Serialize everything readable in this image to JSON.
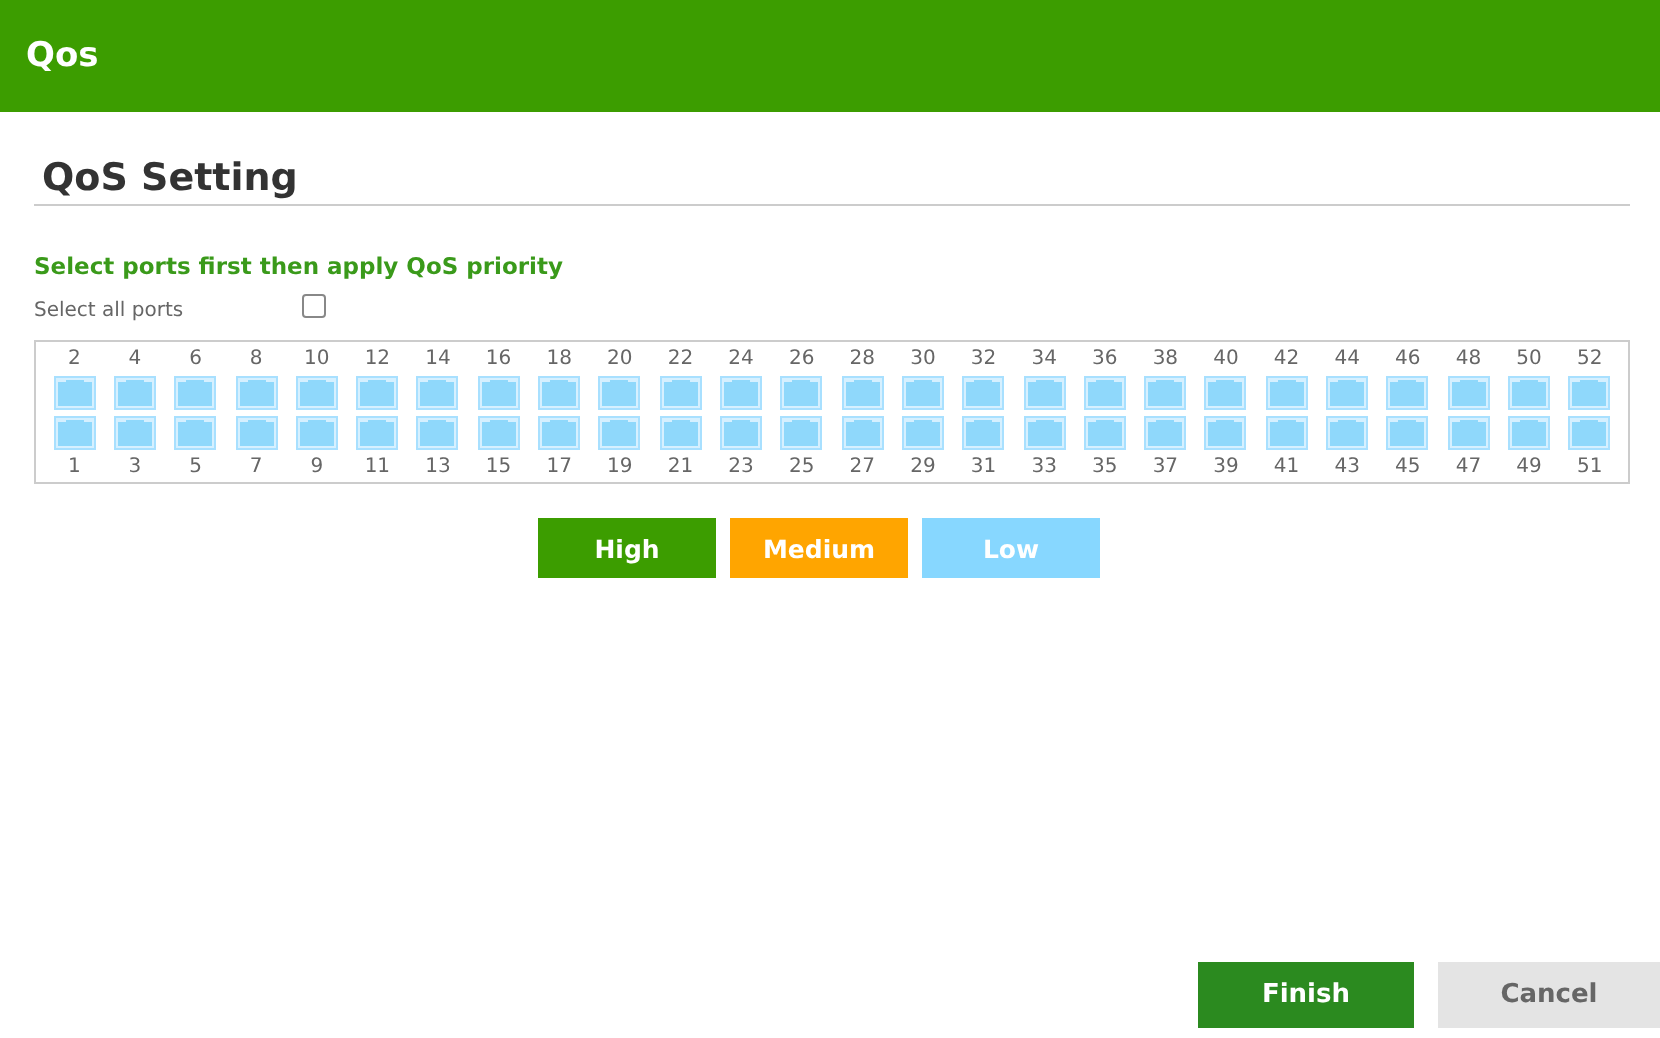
{
  "header": {
    "title": "Qos"
  },
  "section": {
    "title": "QoS Setting"
  },
  "instruction": "Select ports first then apply QoS priority",
  "select_all": {
    "label": "Select all ports",
    "checked": false
  },
  "ports": {
    "top_row": [
      "2",
      "4",
      "6",
      "8",
      "10",
      "12",
      "14",
      "16",
      "18",
      "20",
      "22",
      "24",
      "26",
      "28",
      "30",
      "32",
      "34",
      "36",
      "38",
      "40",
      "42",
      "44",
      "46",
      "48",
      "50",
      "52"
    ],
    "bottom_row": [
      "1",
      "3",
      "5",
      "7",
      "9",
      "11",
      "13",
      "15",
      "17",
      "19",
      "21",
      "23",
      "25",
      "27",
      "29",
      "31",
      "33",
      "35",
      "37",
      "39",
      "41",
      "43",
      "45",
      "47",
      "49",
      "51"
    ]
  },
  "priorities": [
    {
      "label": "High",
      "color": "#3c9d00"
    },
    {
      "label": "Medium",
      "color": "#ffa500"
    },
    {
      "label": "Low",
      "color": "#87d7ff"
    }
  ],
  "footer": {
    "buttons": [
      {
        "label": "Finish",
        "kind": "primary"
      },
      {
        "label": "Cancel",
        "kind": "secondary"
      }
    ]
  }
}
